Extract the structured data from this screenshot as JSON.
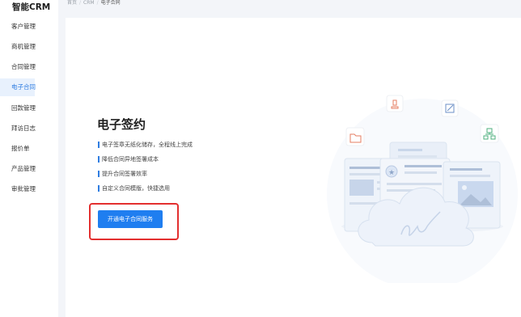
{
  "app": {
    "title": "智能CRM"
  },
  "sidebar": {
    "items": [
      {
        "label": "客户管理",
        "active": false
      },
      {
        "label": "商机管理",
        "active": false
      },
      {
        "label": "合同管理",
        "active": false
      },
      {
        "label": "电子合同",
        "active": true
      },
      {
        "label": "回款管理",
        "active": false
      },
      {
        "label": "拜访日志",
        "active": false
      },
      {
        "label": "报价单",
        "active": false
      },
      {
        "label": "产品管理",
        "active": false
      },
      {
        "label": "审批管理",
        "active": false
      }
    ]
  },
  "breadcrumb": {
    "home": "首页",
    "module": "CRM",
    "current": "电子合同"
  },
  "main": {
    "title": "电子签约",
    "features": [
      "电子签章无纸化储存，全程线上完成",
      "降低合同异地签署成本",
      "提升合同签署效率",
      "自定义合同模版，快捷选用"
    ],
    "cta_label": "开通电子合同服务"
  },
  "colors": {
    "accent": "#1f7ef0",
    "highlight": "#e32f2f",
    "active_bg": "#e8f1fd"
  },
  "illustration": {
    "icons": [
      "stamp-icon",
      "edit-icon",
      "folder-icon",
      "org-chart-icon",
      "star-badge-icon",
      "signature-icon"
    ]
  }
}
